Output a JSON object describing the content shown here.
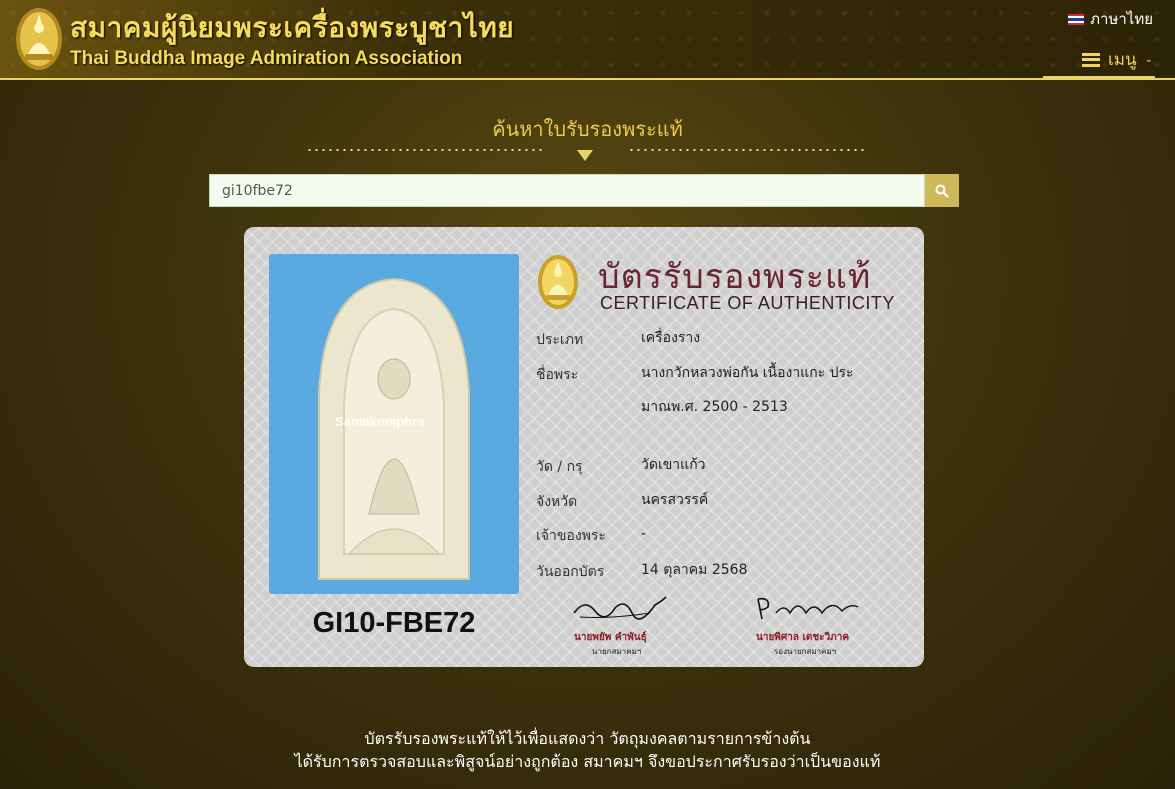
{
  "header": {
    "logo_th": "สมาคมผู้นิยมพระเครื่องพระบูชาไทย",
    "logo_en": "Thai Buddha Image Admiration Association",
    "language_label": "ภาษาไทย",
    "menu_label": "เมนู"
  },
  "search": {
    "title": "ค้นหาใบรับรองพระแท้",
    "value": "gi10fbe72"
  },
  "certificate": {
    "title_th": "บัตรรับรองพระแท้",
    "title_en": "CERTIFICATE OF AUTHENTICITY",
    "watermark": "Samakomphra",
    "code": "GI10-FBE72",
    "fields": [
      {
        "label": "ประเภท",
        "value": "เครื่องราง"
      },
      {
        "label": "ชื่อพระ",
        "value": "นางกวักหลวงพ่อกัน เนื้องาแกะ ประมาณพ.ศ. 2500 - 2513"
      },
      {
        "label": "วัด / กรุ",
        "value": "วัดเขาแก้ว"
      },
      {
        "label": "จังหวัด",
        "value": "นครสวรรค์"
      },
      {
        "label": "เจ้าของพระ",
        "value": "-"
      },
      {
        "label": "วันออกบัตร",
        "value": "14 ตุลาคม 2568"
      }
    ],
    "signatures": [
      {
        "name": "นายพยัพ คำพันธุ์",
        "role": "นายกสมาคมฯ"
      },
      {
        "name": "นายพิศาล เตชะวิภาค",
        "role": "รองนายกสมาคมฯ"
      }
    ]
  },
  "footer": {
    "line1": "บัตรรับรองพระแท้ให้ไว้เพื่อแสดงว่า วัตถุมงคลตามรายการข้างต้น",
    "line2": "ได้รับการตรวจสอบและพิสูจน์อย่างถูกต้อง สมาคมฯ จึงขอประกาศรับรองว่าเป็นของแท้"
  },
  "colors": {
    "accent_gold": "#f0c84a",
    "cert_title": "#6a2432",
    "photo_bg": "#5aa9e0"
  }
}
